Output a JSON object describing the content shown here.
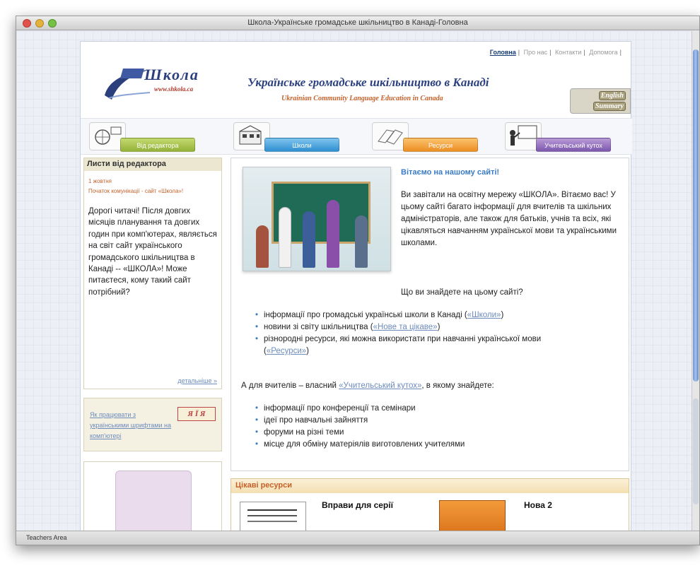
{
  "window": {
    "title": "Школа-Українське громадське шкільництво в Канаді-Головна",
    "status_text": "Teachers Area"
  },
  "top_nav": {
    "items": [
      {
        "label": "Головна",
        "active": true
      },
      {
        "label": "Про нас",
        "active": false
      },
      {
        "label": "Контакти",
        "active": false
      },
      {
        "label": "Допомога",
        "active": false
      }
    ]
  },
  "header": {
    "logo_text": "Школа",
    "logo_url": "www.shkola.ca",
    "site_title": "Українське громадське шкільництво в Канаді",
    "site_subtitle": "Ukrainian Community Language Education in Canada",
    "english_line1": "English",
    "english_line2": "Summary"
  },
  "nav_tiles": [
    {
      "label": "Від редактора",
      "color": "#93b23a",
      "icon": "globe-person-icon"
    },
    {
      "label": "Школи",
      "color": "#2f8fd0",
      "icon": "school-building-icon"
    },
    {
      "label": "Ресурси",
      "color": "#ec8d23",
      "icon": "books-icon"
    },
    {
      "label": "Учительський кутох",
      "color": "#7c57ad",
      "icon": "teacher-board-icon"
    }
  ],
  "editor": {
    "heading": "Листи від редактора",
    "date": "1 жовтня",
    "headline": "Початок комунікації - сайт «Школа»!",
    "body": "Дорогі читачі! Після довгих місяців планування та довгих годин при комп'ютерах, являється на світ сайт українського громадського шкільництва в Канаді -- «ШКОЛА»! Може питаєтеся, кому такий сайт потрібний?",
    "more": "детальніше »"
  },
  "fonts_box": {
    "link": "Як працювати з українськими шрифтами на комп'ютері",
    "badge": "Я Ї Я"
  },
  "welcome": {
    "title": "Вітаємо на нашому сайті!",
    "intro": "Ви завітали на освітну мережу «ШКОЛА». Вітаємо вас! У цьому сайті багато інформації для вчителів та шкільних адміністраторів, але також для батьків, учнів та всіх, які цікавляться навчанням української мови та українськими школами.",
    "question": "Що ви знайдете на цьому сайті?",
    "items": [
      {
        "text": "інформації про громадські українські школи в Канаді",
        "link": "«Школи»"
      },
      {
        "text": "новини зі світу шкільництва",
        "link": "«Нове та цікаве»"
      },
      {
        "text": "різнородні ресурси, які можна використати при навчанні української мови",
        "link": "«Ресурси»"
      }
    ],
    "teachers_prefix": "А для вчителів – власний",
    "teachers_link": "«Учительський кутох»",
    "teachers_suffix": ", в якому знайдете:",
    "teacher_items": [
      "інформації про конференції та семінари",
      "ідеї про навчальні зайняття",
      "форуми на різні теми",
      "місце для обміну матеріялів виготовлених учителями"
    ]
  },
  "resources": {
    "heading": "Цікаві ресурси",
    "item1_title": "Вправи для серії",
    "item2_title": "Нова 2"
  }
}
